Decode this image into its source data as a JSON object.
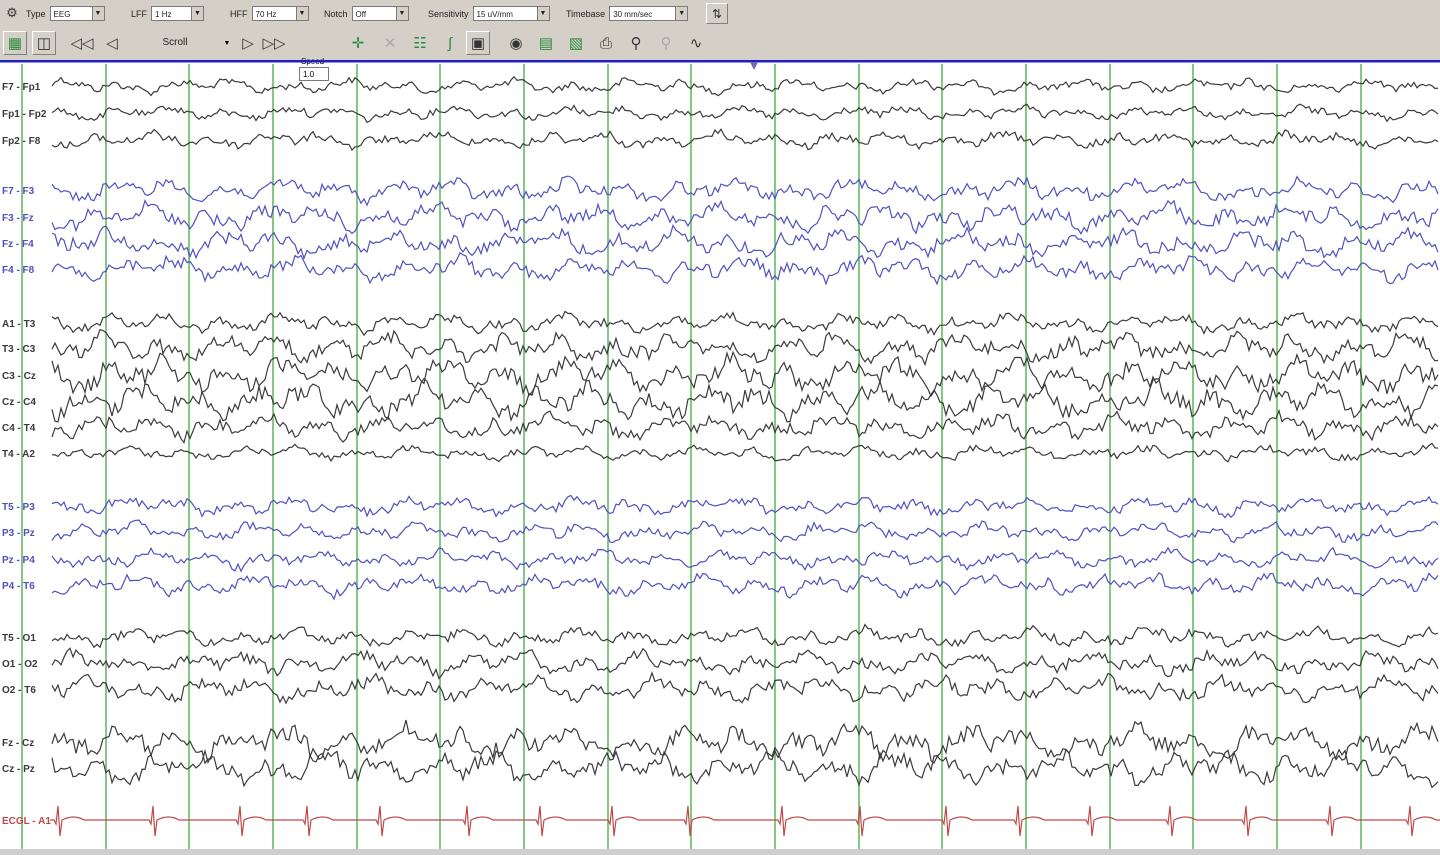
{
  "toolbar": {
    "type": {
      "label": "Type",
      "value": "EEG"
    },
    "lff": {
      "label": "LFF",
      "value": "1 Hz"
    },
    "hff": {
      "label": "HFF",
      "value": "70 Hz"
    },
    "notch": {
      "label": "Notch",
      "value": "Off"
    },
    "sensitivity": {
      "label": "Sensitivity",
      "value": "15 uV/mm"
    },
    "timebase": {
      "label": "Timebase",
      "value": "30 mm/sec"
    }
  },
  "playback": {
    "scroll_label": "Scroll",
    "speed_label": "Speed",
    "speed_value": "1.0"
  },
  "channels": [
    {
      "label": "F7 - Fp1",
      "group": "black"
    },
    {
      "label": "Fp1 - Fp2",
      "group": "black"
    },
    {
      "label": "Fp2 - F8",
      "group": "black"
    },
    {
      "label": "F7 - F3",
      "group": "blue"
    },
    {
      "label": "F3 - Fz",
      "group": "blue"
    },
    {
      "label": "Fz - F4",
      "group": "blue"
    },
    {
      "label": "F4 - F8",
      "group": "blue"
    },
    {
      "label": "A1 - T3",
      "group": "black"
    },
    {
      "label": "T3 - C3",
      "group": "black"
    },
    {
      "label": "C3 - Cz",
      "group": "black"
    },
    {
      "label": "Cz - C4",
      "group": "black"
    },
    {
      "label": "C4 - T4",
      "group": "black"
    },
    {
      "label": "T4 - A2",
      "group": "black"
    },
    {
      "label": "T5 - P3",
      "group": "blue"
    },
    {
      "label": "P3 - Pz",
      "group": "blue"
    },
    {
      "label": "Pz - P4",
      "group": "blue"
    },
    {
      "label": "P4 - T6",
      "group": "blue"
    },
    {
      "label": "T5 - O1",
      "group": "black"
    },
    {
      "label": "O1 - O2",
      "group": "black"
    },
    {
      "label": "O2 - T6",
      "group": "black"
    },
    {
      "label": "Fz - Cz",
      "group": "black"
    },
    {
      "label": "Cz - Pz",
      "group": "black"
    },
    {
      "label": "ECGL - A1",
      "group": "red"
    }
  ],
  "colors": {
    "black": "#3a3a3a",
    "blue": "#5050c0",
    "red": "#c04848",
    "grid": "#6fbf6f",
    "cursor": "#2020c0"
  }
}
